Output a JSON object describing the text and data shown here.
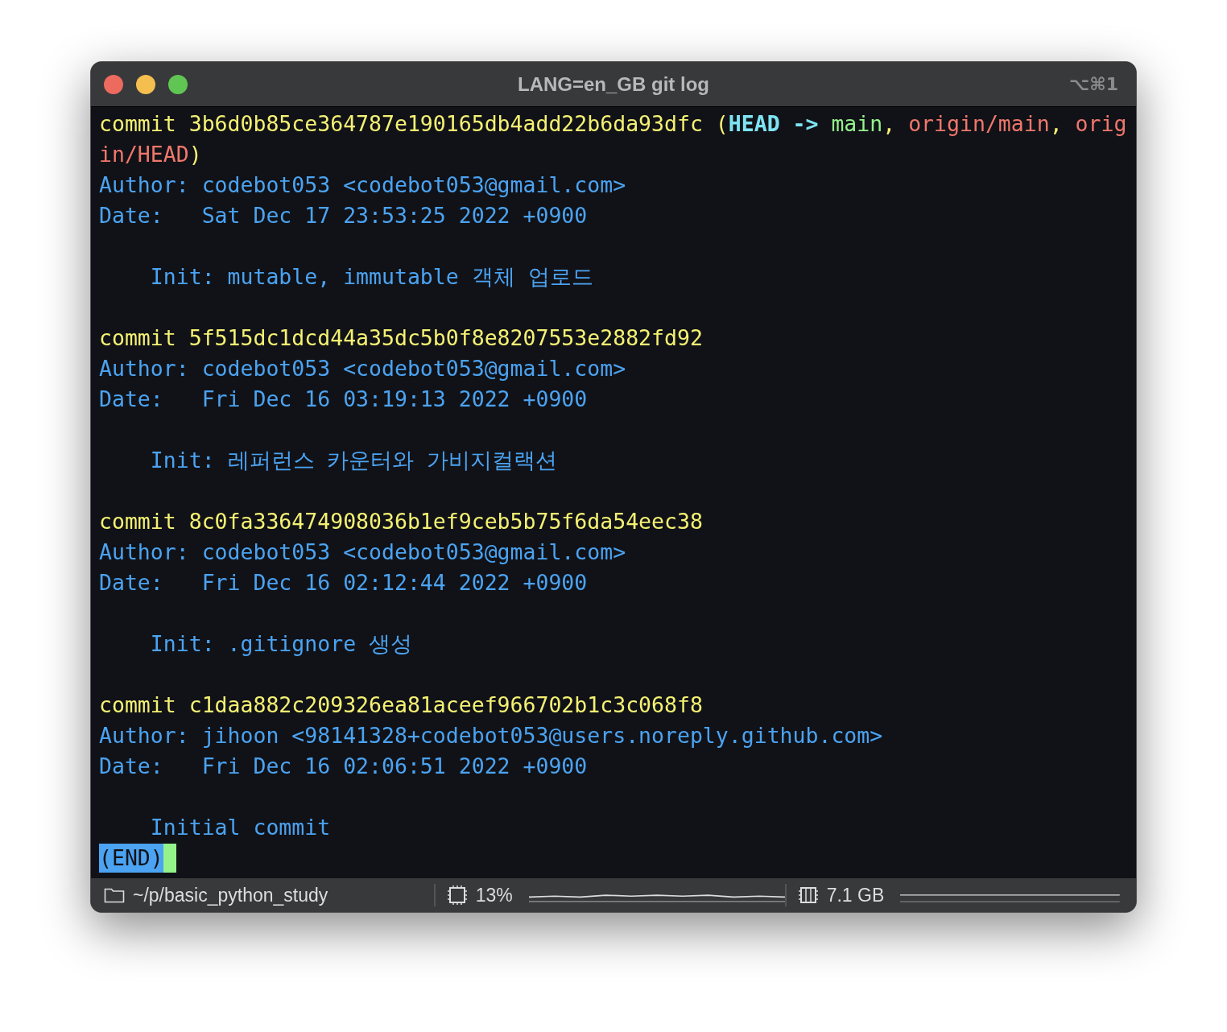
{
  "window": {
    "title": "LANG=en_GB git log",
    "shortcut": "⌥⌘1"
  },
  "lines": [
    {
      "kind": "text",
      "segments": [
        {
          "kind": "hash",
          "text": "commit 3b6d0b85ce364787e190165db4add22b6da93dfc ("
        },
        {
          "kind": "head",
          "text": "HEAD -> "
        },
        {
          "kind": "branch",
          "text": "main"
        },
        {
          "kind": "hash",
          "text": ", "
        },
        {
          "kind": "remote",
          "text": "origin/main"
        },
        {
          "kind": "hash",
          "text": ", "
        },
        {
          "kind": "remote",
          "text": "orig"
        }
      ]
    },
    {
      "kind": "text",
      "segments": [
        {
          "kind": "remote",
          "text": "in/HEAD"
        },
        {
          "kind": "hash",
          "text": ")"
        }
      ]
    },
    {
      "kind": "text",
      "segments": [
        {
          "kind": "info",
          "text": "Author: codebot053 <codebot053@gmail.com>"
        }
      ]
    },
    {
      "kind": "text",
      "segments": [
        {
          "kind": "info",
          "text": "Date:   Sat Dec 17 23:53:25 2022 +0900"
        }
      ]
    },
    {
      "kind": "blank"
    },
    {
      "kind": "text",
      "segments": [
        {
          "kind": "info",
          "text": "    Init: mutable, immutable 객체 업로드"
        }
      ]
    },
    {
      "kind": "blank"
    },
    {
      "kind": "text",
      "segments": [
        {
          "kind": "hash",
          "text": "commit 5f515dc1dcd44a35dc5b0f8e8207553e2882fd92"
        }
      ]
    },
    {
      "kind": "text",
      "segments": [
        {
          "kind": "info",
          "text": "Author: codebot053 <codebot053@gmail.com>"
        }
      ]
    },
    {
      "kind": "text",
      "segments": [
        {
          "kind": "info",
          "text": "Date:   Fri Dec 16 03:19:13 2022 +0900"
        }
      ]
    },
    {
      "kind": "blank"
    },
    {
      "kind": "text",
      "segments": [
        {
          "kind": "info",
          "text": "    Init: 레퍼런스 카운터와 가비지컬랙션"
        }
      ]
    },
    {
      "kind": "blank"
    },
    {
      "kind": "text",
      "segments": [
        {
          "kind": "hash",
          "text": "commit 8c0fa336474908036b1ef9ceb5b75f6da54eec38"
        }
      ]
    },
    {
      "kind": "text",
      "segments": [
        {
          "kind": "info",
          "text": "Author: codebot053 <codebot053@gmail.com>"
        }
      ]
    },
    {
      "kind": "text",
      "segments": [
        {
          "kind": "info",
          "text": "Date:   Fri Dec 16 02:12:44 2022 +0900"
        }
      ]
    },
    {
      "kind": "blank"
    },
    {
      "kind": "text",
      "segments": [
        {
          "kind": "info",
          "text": "    Init: .gitignore 생성"
        }
      ]
    },
    {
      "kind": "blank"
    },
    {
      "kind": "text",
      "segments": [
        {
          "kind": "hash",
          "text": "commit c1daa882c209326ea81aceef966702b1c3c068f8"
        }
      ]
    },
    {
      "kind": "text",
      "segments": [
        {
          "kind": "info",
          "text": "Author: jihoon <98141328+codebot053@users.noreply.github.com>"
        }
      ]
    },
    {
      "kind": "text",
      "segments": [
        {
          "kind": "info",
          "text": "Date:   Fri Dec 16 02:06:51 2022 +0900"
        }
      ]
    },
    {
      "kind": "blank"
    },
    {
      "kind": "text",
      "segments": [
        {
          "kind": "info",
          "text": "    Initial commit"
        }
      ]
    }
  ],
  "prompt": "(END)",
  "status_bar": {
    "path": "~/p/basic_python_study",
    "cpu": "13%",
    "memory": "7.1 GB"
  }
}
